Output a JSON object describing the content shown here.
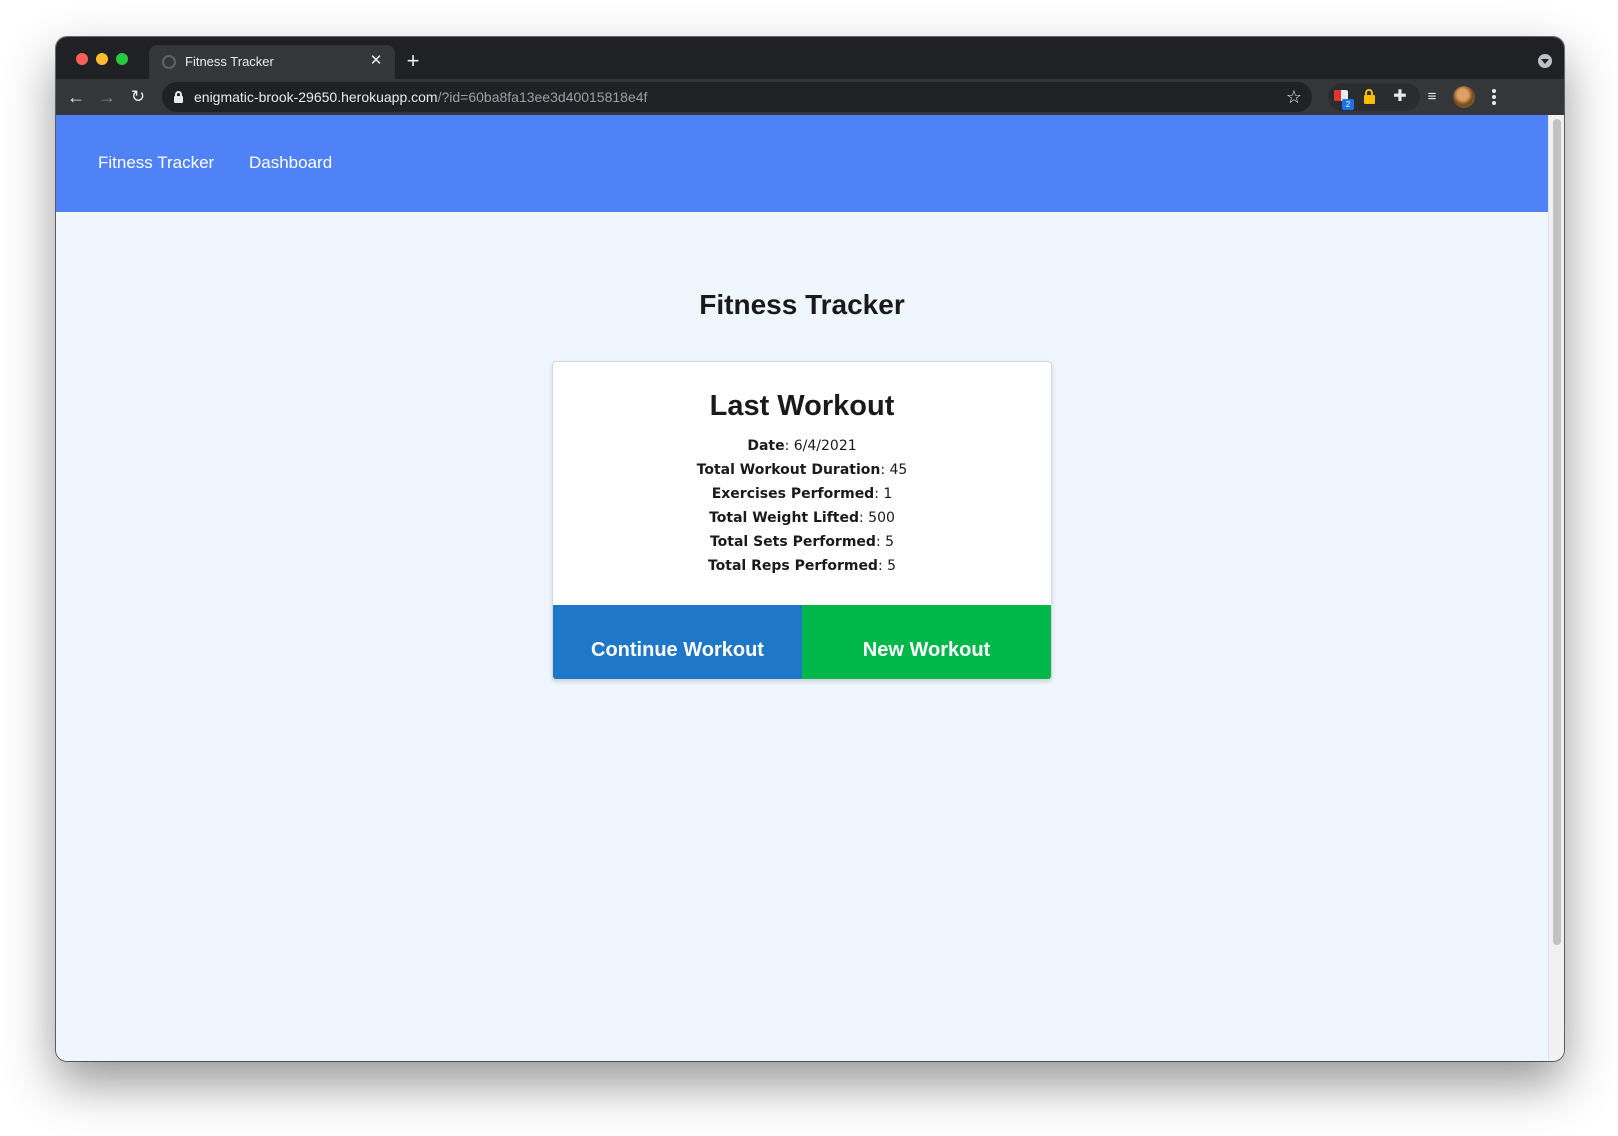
{
  "browser": {
    "tab_title": "Fitness Tracker",
    "url_host": "enigmatic-brook-29650.herokuapp.com",
    "url_path": "/?id=60ba8fa13ee3d40015818e4f",
    "extension_badge_count": "2",
    "icons": {
      "back": "arrow-left-icon",
      "forward": "arrow-right-icon",
      "reload": "reload-icon",
      "bookmark": "star-icon",
      "new_tab": "plus-icon",
      "close_tab": "close-icon"
    }
  },
  "nav": {
    "brand": "Fitness Tracker",
    "dashboard": "Dashboard",
    "background_color": "#4f82f7"
  },
  "page": {
    "title": "Fitness Tracker",
    "background_color": "#eff6fe"
  },
  "last_workout": {
    "title": "Last Workout",
    "stats": [
      {
        "label": "Date",
        "value": "6/4/2021"
      },
      {
        "label": "Total Workout Duration",
        "value": "45"
      },
      {
        "label": "Exercises Performed",
        "value": "1"
      },
      {
        "label": "Total Weight Lifted",
        "value": "500"
      },
      {
        "label": "Total Sets Performed",
        "value": "5"
      },
      {
        "label": "Total Reps Performed",
        "value": "5"
      }
    ]
  },
  "actions": {
    "continue_label": "Continue Workout",
    "continue_color": "#1f77c7",
    "new_label": "New Workout",
    "new_color": "#00b74a"
  }
}
